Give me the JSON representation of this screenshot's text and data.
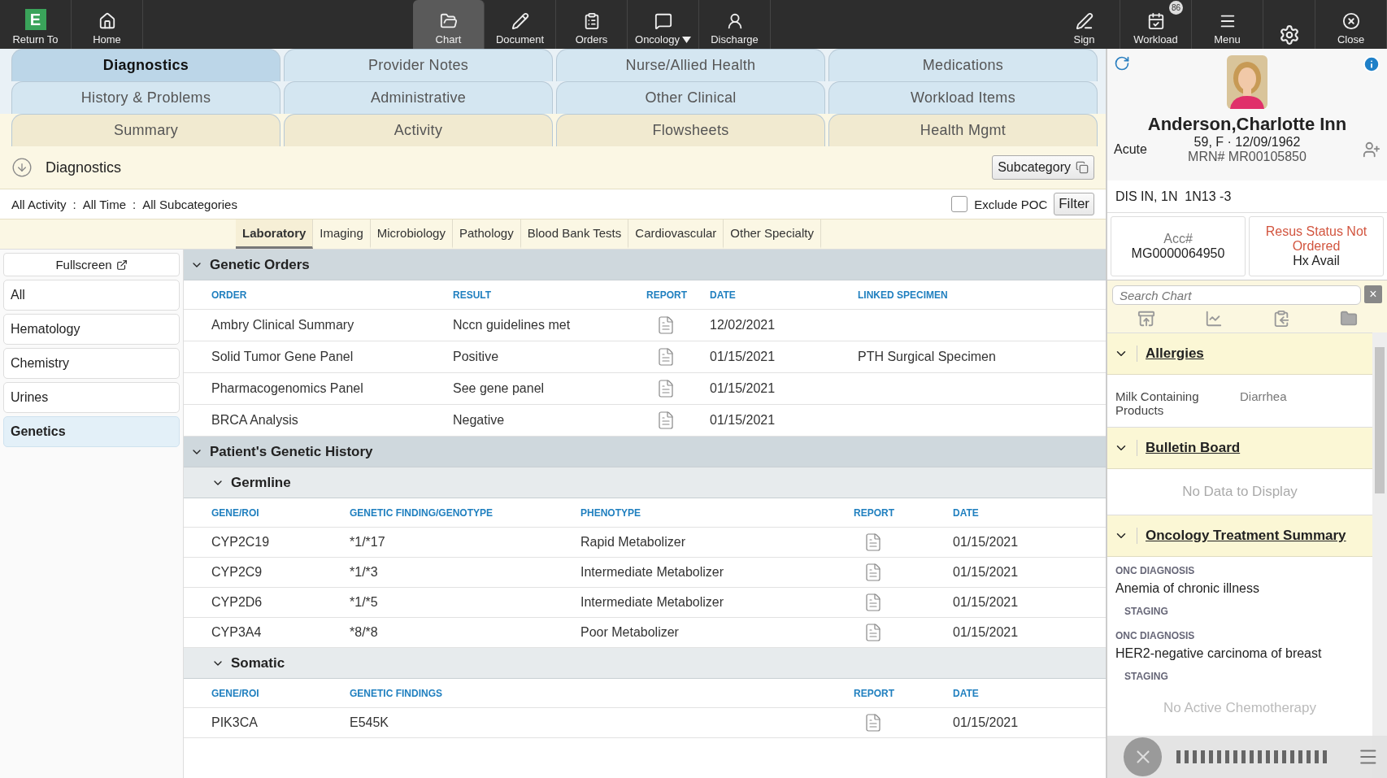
{
  "toolbar": {
    "left": [
      {
        "kind": "return",
        "logo_letter": "E",
        "label": "Return To"
      },
      {
        "kind": "home",
        "label": "Home"
      }
    ],
    "center": [
      {
        "kind": "chart",
        "label": "Chart",
        "selected": true,
        "dropdown": false
      },
      {
        "kind": "document",
        "label": "Document",
        "selected": false,
        "dropdown": false
      },
      {
        "kind": "orders",
        "label": "Orders",
        "selected": false,
        "dropdown": false
      },
      {
        "kind": "oncology",
        "label": "Oncology",
        "selected": false,
        "dropdown": true
      },
      {
        "kind": "discharge",
        "label": "Discharge",
        "selected": false,
        "dropdown": false
      }
    ],
    "right": [
      {
        "kind": "sign",
        "label": "Sign"
      },
      {
        "kind": "workload",
        "label": "Workload",
        "badge": "86"
      },
      {
        "kind": "menu",
        "label": "Menu"
      },
      {
        "kind": "settings"
      },
      {
        "kind": "close",
        "label": "Close"
      }
    ]
  },
  "tab_rows": [
    {
      "kind": "category",
      "tabs": [
        {
          "label": "Diagnostics",
          "selected": true
        },
        {
          "label": "Provider Notes",
          "selected": false
        },
        {
          "label": "Nurse/Allied Health",
          "selected": false
        },
        {
          "label": "Medications",
          "selected": false
        }
      ]
    },
    {
      "kind": "category",
      "tabs": [
        {
          "label": "History & Problems",
          "selected": false
        },
        {
          "label": "Administrative",
          "selected": false
        },
        {
          "label": "Other Clinical",
          "selected": false
        },
        {
          "label": "Workload Items",
          "selected": false
        }
      ]
    },
    {
      "kind": "summary",
      "tabs": [
        {
          "label": "Summary",
          "selected": false
        },
        {
          "label": "Activity",
          "selected": false
        },
        {
          "label": "Flowsheets",
          "selected": false
        },
        {
          "label": "Health Mgmt",
          "selected": false
        }
      ]
    }
  ],
  "header": {
    "title": "Diagnostics",
    "button": "Subcategory"
  },
  "filter": {
    "crumbs": [
      "All Activity",
      "All Time",
      "All Subcategories"
    ],
    "separator": ":",
    "exclude_poc": {
      "label": "Exclude POC",
      "checked": false
    },
    "button": "Filter"
  },
  "subtabs": [
    {
      "label": "Laboratory",
      "selected": true
    },
    {
      "label": "Imaging",
      "selected": false
    },
    {
      "label": "Microbiology",
      "selected": false
    },
    {
      "label": "Pathology",
      "selected": false
    },
    {
      "label": "Blood Bank Tests",
      "selected": false
    },
    {
      "label": "Cardiovascular",
      "selected": false
    },
    {
      "label": "Other Specialty",
      "selected": false
    }
  ],
  "sidebar": {
    "fullscreen": "Fullscreen",
    "items": [
      {
        "label": "All",
        "selected": false
      },
      {
        "label": "Hematology",
        "selected": false
      },
      {
        "label": "Chemistry",
        "selected": false
      },
      {
        "label": "Urines",
        "selected": false
      },
      {
        "label": "Genetics",
        "selected": true
      }
    ]
  },
  "sections": [
    {
      "title": "Genetic Orders",
      "expanded": true,
      "kind": "orders",
      "columns": [
        {
          "label": "ORDER",
          "kind": "text"
        },
        {
          "label": "RESULT",
          "kind": "text"
        },
        {
          "label": "REPORT",
          "kind": "icon"
        },
        {
          "label": "DATE",
          "kind": "text"
        },
        {
          "label": "LINKED SPECIMEN",
          "kind": "text"
        }
      ],
      "rows": [
        {
          "cells": [
            "Ambry Clinical Summary",
            "Nccn guidelines met",
            "",
            "12/02/2021"
          ],
          "report": true
        },
        {
          "cells": [
            "Solid Tumor Gene Panel",
            "Positive",
            "",
            "01/15/2021",
            "PTH Surgical Specimen"
          ],
          "report": true
        },
        {
          "cells": [
            "Pharmacogenomics Panel",
            "See gene panel",
            "",
            "01/15/2021"
          ],
          "report": true
        },
        {
          "cells": [
            "BRCA Analysis",
            "Negative",
            "",
            "01/15/2021"
          ],
          "report": true
        }
      ]
    },
    {
      "title": "Patient's Genetic History",
      "expanded": true,
      "children": [
        {
          "title": "Germline",
          "expanded": true,
          "kind": "germline",
          "columns": [
            {
              "label": "GENE/ROI",
              "kind": "text"
            },
            {
              "label": "GENETIC FINDING/GENOTYPE",
              "kind": "text"
            },
            {
              "label": "PHENOTYPE",
              "kind": "text"
            },
            {
              "label": "REPORT",
              "kind": "icon"
            },
            {
              "label": "DATE",
              "kind": "text"
            }
          ],
          "rows": [
            {
              "cells": [
                "CYP2C19",
                "*1/*17",
                "Rapid Metabolizer",
                "",
                "01/15/2021"
              ],
              "report": true
            },
            {
              "cells": [
                "CYP2C9",
                "*1/*3",
                "Intermediate Metabolizer",
                "",
                "01/15/2021"
              ],
              "report": true
            },
            {
              "cells": [
                "CYP2D6",
                "*1/*5",
                "Intermediate Metabolizer",
                "",
                "01/15/2021"
              ],
              "report": true
            },
            {
              "cells": [
                "CYP3A4",
                "*8/*8",
                "Poor Metabolizer",
                "",
                "01/15/2021"
              ],
              "report": true
            }
          ]
        },
        {
          "title": "Somatic",
          "expanded": true,
          "kind": "somatic",
          "columns": [
            {
              "label": "GENE/ROI",
              "kind": "text"
            },
            {
              "label": "GENETIC FINDINGS",
              "kind": "text"
            },
            {
              "label": "REPORT",
              "kind": "icon"
            },
            {
              "label": "DATE",
              "kind": "text"
            }
          ],
          "rows": [
            {
              "cells": [
                "PIK3CA",
                "E545K",
                "",
                "01/15/2021"
              ],
              "report": true
            }
          ]
        }
      ]
    }
  ],
  "patient": {
    "name": "Anderson,Charlotte Inn",
    "encounter": "Acute",
    "demographics": "59, F · 12/09/1962",
    "mrn": "MRN# MR00105850",
    "location": "DIS IN, 1N  1N13 -3",
    "acc_label": "Acc#",
    "acc": "MG0000064950",
    "resus": "Resus Status Not Ordered",
    "history": "Hx Avail"
  },
  "chart_search": {
    "placeholder": "Search Chart",
    "clear": "×"
  },
  "summary_sections": [
    {
      "title": "Allergies",
      "expanded": true,
      "kind": "allergies",
      "items": [
        {
          "substance": "Milk Containing Products",
          "reaction": "Diarrhea"
        }
      ]
    },
    {
      "title": "Bulletin Board",
      "expanded": true,
      "kind": "empty",
      "message": "No Data to Display"
    },
    {
      "title": "Oncology Treatment Summary",
      "expanded": true,
      "kind": "oncology",
      "items": [
        {
          "label": "ONC DIAGNOSIS",
          "value": "Anemia of chronic illness",
          "sub": "STAGING"
        },
        {
          "label": "ONC DIAGNOSIS",
          "value": "HER2-negative carcinoma of breast",
          "sub": "STAGING"
        }
      ],
      "footer": "No Active Chemotherapy"
    }
  ]
}
